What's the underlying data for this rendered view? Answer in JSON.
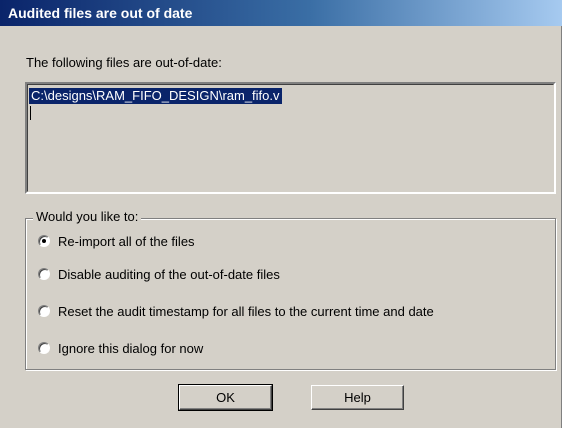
{
  "dialog": {
    "title": "Audited files are out of date",
    "files_label": "The following files are out-of-date:",
    "files": [
      "C:\\designs\\RAM_FIFO_DESIGN\\ram_fifo.v"
    ],
    "group_label": "Would you like to:",
    "options": [
      {
        "label": "Re-import all of the files",
        "selected": true
      },
      {
        "label": "Disable auditing of the out-of-date files",
        "selected": false
      },
      {
        "label": "Reset the audit timestamp for all files to the current time and date",
        "selected": false
      },
      {
        "label": "Ignore this dialog for now",
        "selected": false
      }
    ],
    "buttons": {
      "ok": "OK",
      "help": "Help"
    }
  },
  "colors": {
    "title_bar_start": "#0a246a",
    "title_bar_end": "#a6caf0",
    "dialog_background": "#d4d0c8",
    "selection_highlight": "#0a246a"
  }
}
